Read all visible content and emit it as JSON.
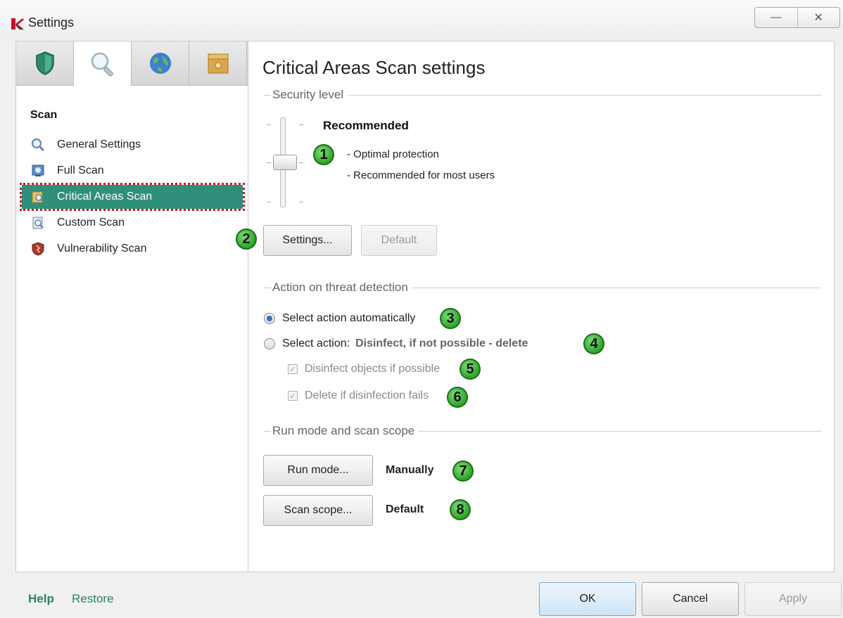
{
  "window": {
    "title": "Settings",
    "minimize_glyph": "—",
    "close_glyph": "✕"
  },
  "tabs": [
    {
      "icon": "shield-icon",
      "active": false
    },
    {
      "icon": "magnifier-icon",
      "active": true
    },
    {
      "icon": "globe-icon",
      "active": false
    },
    {
      "icon": "box-icon",
      "active": false
    }
  ],
  "sidebar": {
    "section_title": "Scan",
    "items": [
      {
        "label": "General Settings",
        "icon": "search-icon"
      },
      {
        "label": "Full Scan",
        "icon": "full-scan-icon"
      },
      {
        "label": "Critical Areas Scan",
        "icon": "critical-scan-icon",
        "active": true
      },
      {
        "label": "Custom Scan",
        "icon": "custom-scan-icon"
      },
      {
        "label": "Vulnerability Scan",
        "icon": "vulnerability-icon"
      }
    ]
  },
  "main": {
    "title": "Critical Areas Scan settings",
    "security_level": {
      "group_label": "Security level",
      "level_name": "Recommended",
      "desc1": "- Optimal protection",
      "desc2": "- Recommended for most users",
      "settings_button": "Settings...",
      "default_button": "Default"
    },
    "threat_action": {
      "group_label": "Action on threat detection",
      "auto_label": "Select action automatically",
      "select_label": "Select action:",
      "select_value": "Disinfect, if not possible - delete",
      "disinfect_label": "Disinfect objects if possible",
      "delete_label": "Delete if disinfection fails"
    },
    "run_mode": {
      "group_label": "Run mode and scan scope",
      "run_mode_button": "Run mode...",
      "run_mode_value": "Manually",
      "scan_scope_button": "Scan scope...",
      "scan_scope_value": "Default"
    },
    "badges": [
      "1",
      "2",
      "3",
      "4",
      "5",
      "6",
      "7",
      "8"
    ]
  },
  "footer": {
    "help": "Help",
    "restore": "Restore",
    "ok": "OK",
    "cancel": "Cancel",
    "apply": "Apply"
  },
  "colors": {
    "accent": "#2f8f7a",
    "badge_green": "#2fa32a",
    "highlight_border": "#d4141d"
  }
}
